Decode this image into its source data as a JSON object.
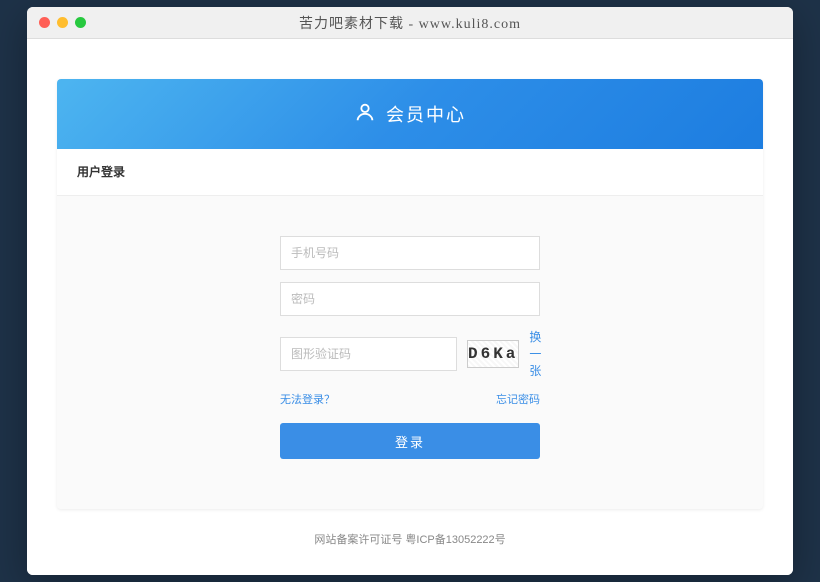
{
  "window": {
    "title": "苦力吧素材下载 - www.kuli8.com"
  },
  "header": {
    "title": "会员中心"
  },
  "tabs": {
    "login": "用户登录"
  },
  "form": {
    "phone_placeholder": "手机号码",
    "password_placeholder": "密码",
    "captcha_placeholder": "图形验证码",
    "captcha_value": "D6Ka",
    "refresh_captcha": "换一张",
    "cannot_login": "无法登录？",
    "forgot_password": "忘记密码",
    "submit": "登录"
  },
  "footer": {
    "license_label": "网站备案许可证号",
    "license_no": "粤ICP备13052222号"
  }
}
